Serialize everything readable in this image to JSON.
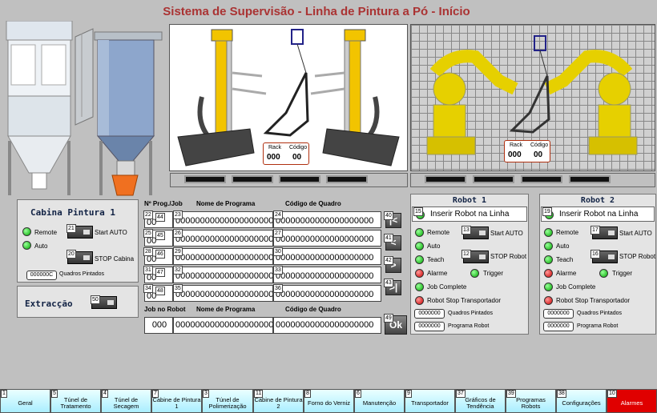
{
  "title": "Sistema de Supervisão - Linha de Pintura a Pó - Início",
  "scene": {
    "left_counter": {
      "rack_label": "Rack",
      "rack_value": "000",
      "code_label": "Código",
      "code_value": "00"
    },
    "right_counter": {
      "rack_label": "Rack",
      "rack_value": "000",
      "code_label": "Código",
      "code_value": "00"
    }
  },
  "cabina": {
    "title": "Cabina Pintura 1",
    "remote": "Remote",
    "auto": "Auto",
    "start_num": "21",
    "start_label": "Start AUTO",
    "stop_num": "20",
    "stop_label": "STOP Cabina",
    "quadros_value": "000000C",
    "quadros_label": "Quadros Pintados"
  },
  "extraccao": {
    "label": "Extracção",
    "num": "50"
  },
  "program_table": {
    "headers": {
      "prog_job": "Nº Prog./Job",
      "nome": "Nome de Programa",
      "codigo": "Código de Quadro"
    },
    "rows": [
      {
        "n1": "22",
        "n2": "44",
        "prog": "00",
        "n3": "23",
        "nome": "00000000000000000000",
        "n4": "24",
        "codigo": "00000000000000000000"
      },
      {
        "n1": "25",
        "n2": "45",
        "prog": "00",
        "n3": "26",
        "nome": "00000000000000000000",
        "n4": "27",
        "codigo": "00000000000000000000"
      },
      {
        "n1": "28",
        "n2": "46",
        "prog": "00",
        "n3": "29",
        "nome": "00000000000000000000",
        "n4": "30",
        "codigo": "00000000000000000000"
      },
      {
        "n1": "31",
        "n2": "47",
        "prog": "00",
        "n3": "32",
        "nome": "00000000000000000000",
        "n4": "33",
        "codigo": "00000000000000000000"
      },
      {
        "n1": "34",
        "n2": "48",
        "prog": "00",
        "n3": "35",
        "nome": "00000000000000000000",
        "n4": "36",
        "codigo": "00000000000000000000"
      }
    ],
    "nav": [
      {
        "num": "40",
        "label": "|<"
      },
      {
        "num": "41",
        "label": "<"
      },
      {
        "num": "42",
        "label": ">"
      },
      {
        "num": "43",
        "label": ">|"
      }
    ],
    "robot_headers": {
      "job": "Job no Robot",
      "nome": "Nome de Programa",
      "codigo": "Código de Quadro"
    },
    "robot_row": {
      "job": "000",
      "nome": "00000000000000000000",
      "codigo": "00000000000000000000"
    },
    "ok_num": "49",
    "ok_label": "Ok"
  },
  "robot1": {
    "title": "Robot 1",
    "insert_num": "15",
    "insert_label": "Inserir Robot na Linha",
    "remote": "Remote",
    "auto": "Auto",
    "teach": "Teach",
    "alarme": "Alarme",
    "trigger": "Trigger",
    "job_complete": "Job Complete",
    "robot_stop": "Robot Stop Transportador",
    "start_num": "13",
    "start_label": "Start AUTO",
    "stop_num": "12",
    "stop_label": "STOP Robot",
    "quadros_value": "0000000",
    "quadros_label": "Quadros Pintados",
    "programa_value": "0000000",
    "programa_label": "Programa Robot"
  },
  "robot2": {
    "title": "Robot 2",
    "insert_num": "19",
    "insert_label": "Inserir Robot na Linha",
    "remote": "Remote",
    "auto": "Auto",
    "teach": "Teach",
    "alarme": "Alarme",
    "trigger": "Trigger",
    "job_complete": "Job Complete",
    "robot_stop": "Robot Stop Transportador",
    "start_num": "17",
    "start_label": "Start AUTO",
    "stop_num": "16",
    "stop_label": "STOP Robot",
    "quadros_value": "0000000",
    "quadros_label": "Quadros Pintados",
    "programa_value": "0000000",
    "programa_label": "Programa Robot"
  },
  "tabs": [
    {
      "num": "1",
      "label": "Geral"
    },
    {
      "num": "5",
      "label": "Túnel de Tratamento"
    },
    {
      "num": "4",
      "label": "Túnel de Secagem"
    },
    {
      "num": "7",
      "label": "Cabine de Pintura 1"
    },
    {
      "num": "3",
      "label": "Túnel de Polimerização"
    },
    {
      "num": "11",
      "label": "Cabine de Pintura 2"
    },
    {
      "num": "8",
      "label": "Forno do Verniz"
    },
    {
      "num": "6",
      "label": "Manutenção"
    },
    {
      "num": "9",
      "label": "Transportador"
    },
    {
      "num": "37",
      "label": "Gráficos de Tendência"
    },
    {
      "num": "39",
      "label": "Programas Robots"
    },
    {
      "num": "38",
      "label": "Configurações"
    },
    {
      "num": "10",
      "label": "Alarmes"
    }
  ],
  "colors": {
    "title": "#aa3333",
    "tab_bg": "#aaeeff",
    "alarm_tab": "#e00000",
    "led_on": "#00aa00",
    "led_alarm": "#cc0000",
    "robot_yellow": "#e6d000"
  }
}
